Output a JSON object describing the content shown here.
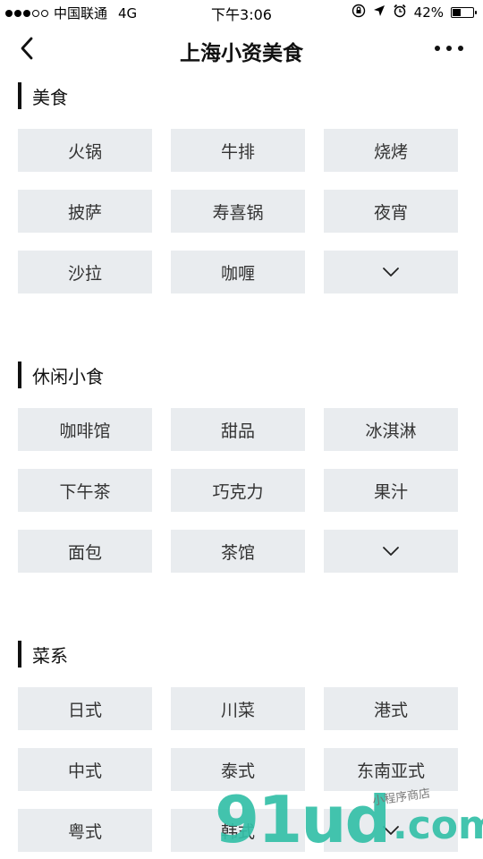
{
  "status_bar": {
    "carrier": "中国联通",
    "network": "4G",
    "time": "下午3:06",
    "battery": "42%",
    "battery_level": 0.42,
    "signal_filled": 3,
    "signal_total": 5
  },
  "nav": {
    "title": "上海小资美食",
    "back_icon": "chevron-left-icon",
    "more_icon": "more-horizontal-icon"
  },
  "sections": [
    {
      "title": "美食",
      "tags": [
        "火锅",
        "牛排",
        "烧烤",
        "披萨",
        "寿喜锅",
        "夜宵",
        "沙拉",
        "咖喱"
      ],
      "expand_icon": "chevron-down-icon"
    },
    {
      "title": "休闲小食",
      "tags": [
        "咖啡馆",
        "甜品",
        "冰淇淋",
        "下午茶",
        "巧克力",
        "果汁",
        "面包",
        "茶馆"
      ],
      "expand_icon": "chevron-down-icon"
    },
    {
      "title": "菜系",
      "tags": [
        "日式",
        "川菜",
        "港式",
        "中式",
        "泰式",
        "东南亚式",
        "粤式",
        "韩式"
      ],
      "expand_icon": "chevron-down-icon"
    }
  ],
  "watermark": {
    "brand": "91ud",
    "domain": ".com",
    "tagline": "小程序商店"
  },
  "colors": {
    "tag_background": "#e9ecef",
    "tag_text": "#333333",
    "title_text": "#111111",
    "watermark": "#34c0a8"
  }
}
